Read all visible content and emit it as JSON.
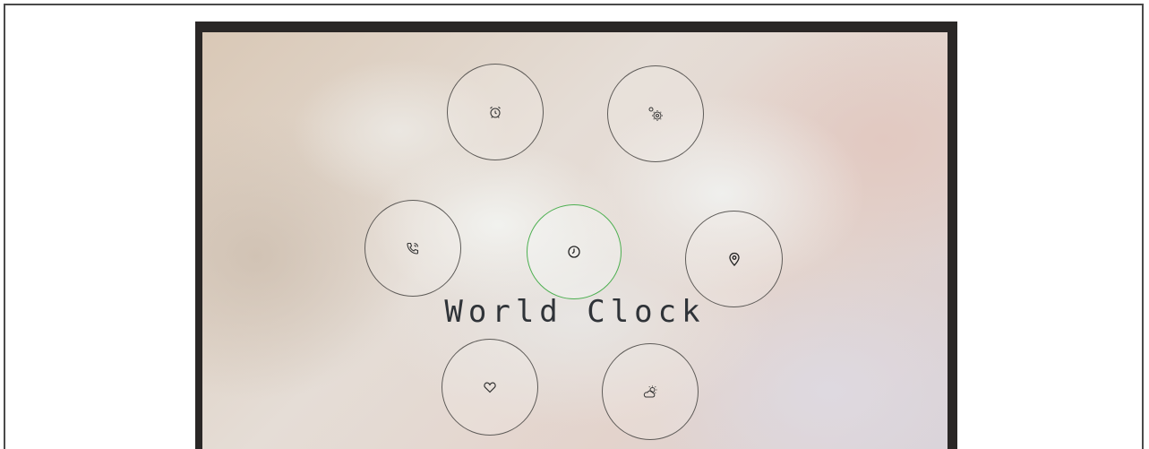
{
  "screen": {
    "title": "World Clock"
  },
  "menu": {
    "items": [
      {
        "id": "alarm",
        "icon": "alarm-clock-icon",
        "active": false
      },
      {
        "id": "settings",
        "icon": "settings-gears-icon",
        "active": false
      },
      {
        "id": "phone",
        "icon": "phone-call-icon",
        "active": false
      },
      {
        "id": "world-clock",
        "icon": "clock-icon",
        "active": true
      },
      {
        "id": "location",
        "icon": "location-pin-icon",
        "active": false
      },
      {
        "id": "health",
        "icon": "heart-icon",
        "active": false
      },
      {
        "id": "weather",
        "icon": "weather-cloud-sun-icon",
        "active": false
      }
    ]
  },
  "colors": {
    "active_ring": "#4caf50",
    "ring": "#5e5b58",
    "text": "#2f3338"
  }
}
